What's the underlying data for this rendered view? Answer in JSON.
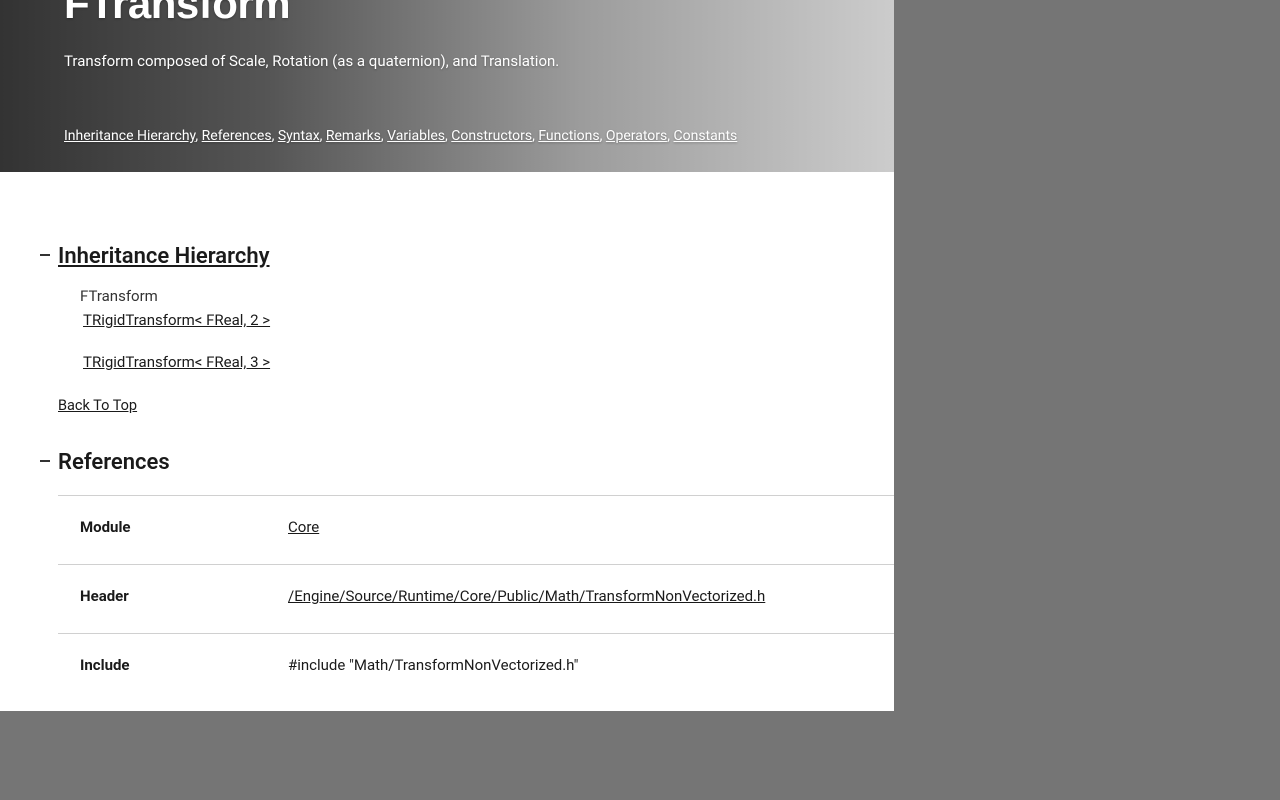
{
  "hero": {
    "title": "FTransform",
    "description": "Transform composed of Scale, Rotation (as a quaternion), and Translation.",
    "nav": [
      "Inheritance Hierarchy",
      "References",
      "Syntax",
      "Remarks",
      "Variables",
      "Constructors",
      "Functions",
      "Operators",
      "Constants"
    ]
  },
  "inheritance": {
    "heading": "Inheritance Hierarchy",
    "root": "FTransform",
    "children": [
      "TRigidTransform< FReal, 2 >",
      "TRigidTransform< FReal, 3 >"
    ],
    "back": "Back To Top"
  },
  "references": {
    "heading": "References",
    "rows": [
      {
        "label": "Module",
        "value": "Core",
        "link": true
      },
      {
        "label": "Header",
        "value": "/Engine/Source/Runtime/Core/Public/Math/TransformNonVectorized.h",
        "link": true
      },
      {
        "label": "Include",
        "value": "#include \"Math/TransformNonVectorized.h\"",
        "link": false
      }
    ]
  }
}
